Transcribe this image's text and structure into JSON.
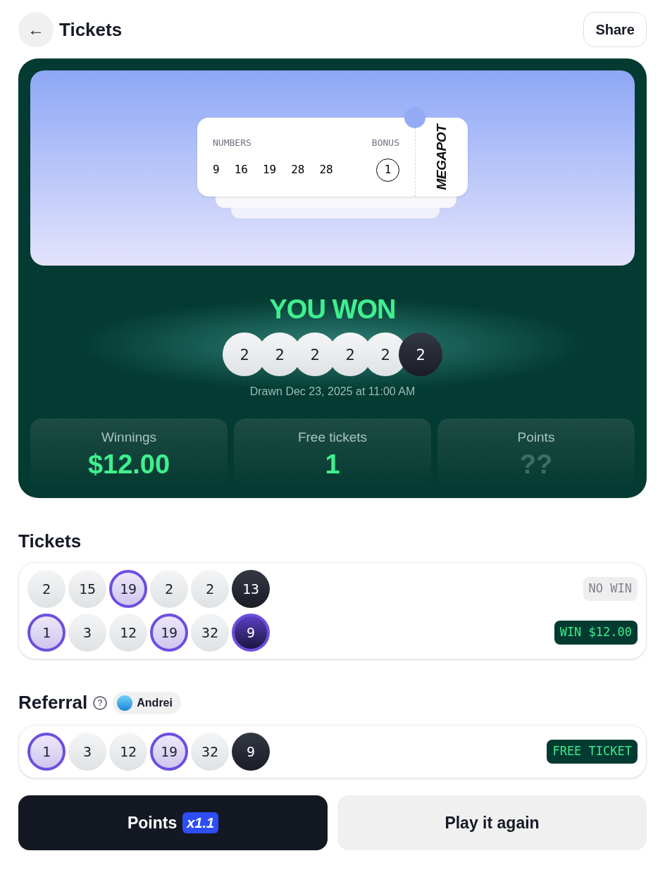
{
  "header": {
    "back": "←",
    "title": "Tickets",
    "share": "Share"
  },
  "hero": {
    "ticket": {
      "numbers_label": "NUMBERS",
      "bonus_label": "BONUS",
      "numbers": [
        "9",
        "16",
        "19",
        "28",
        "28"
      ],
      "bonus": "1",
      "brand": "MEGAPOT"
    }
  },
  "result": {
    "title": "YOU WON",
    "balls": [
      {
        "value": "2",
        "bonus": false
      },
      {
        "value": "2",
        "bonus": false
      },
      {
        "value": "2",
        "bonus": false
      },
      {
        "value": "2",
        "bonus": false
      },
      {
        "value": "2",
        "bonus": false
      },
      {
        "value": "2",
        "bonus": true
      }
    ],
    "drawn": "Drawn Dec 23, 2025 at 11:00 AM"
  },
  "stats": [
    {
      "label": "Winnings",
      "value": "$12.00",
      "revealed": true
    },
    {
      "label": "Free tickets",
      "value": "1",
      "revealed": true
    },
    {
      "label": "Points",
      "value": "??",
      "revealed": false
    }
  ],
  "tickets": {
    "heading": "Tickets",
    "rows": [
      {
        "balls": [
          {
            "value": "2",
            "matched": false,
            "bonus": false
          },
          {
            "value": "15",
            "matched": false,
            "bonus": false
          },
          {
            "value": "19",
            "matched": true,
            "bonus": false
          },
          {
            "value": "2",
            "matched": false,
            "bonus": false
          },
          {
            "value": "2",
            "matched": false,
            "bonus": false
          },
          {
            "value": "13",
            "matched": false,
            "bonus": true
          }
        ],
        "badge": {
          "kind": "no_win",
          "text": "NO WIN"
        }
      },
      {
        "balls": [
          {
            "value": "1",
            "matched": true,
            "bonus": false
          },
          {
            "value": "3",
            "matched": false,
            "bonus": false
          },
          {
            "value": "12",
            "matched": false,
            "bonus": false
          },
          {
            "value": "19",
            "matched": true,
            "bonus": false
          },
          {
            "value": "32",
            "matched": false,
            "bonus": false
          },
          {
            "value": "9",
            "matched": true,
            "bonus": true
          }
        ],
        "badge": {
          "kind": "win",
          "text": "WIN $12.00"
        }
      }
    ]
  },
  "referral": {
    "heading": "Referral",
    "help": "?",
    "user": "Andrei",
    "rows": [
      {
        "balls": [
          {
            "value": "1",
            "matched": true,
            "bonus": false
          },
          {
            "value": "3",
            "matched": false,
            "bonus": false
          },
          {
            "value": "12",
            "matched": false,
            "bonus": false
          },
          {
            "value": "19",
            "matched": true,
            "bonus": false
          },
          {
            "value": "32",
            "matched": false,
            "bonus": false
          },
          {
            "value": "9",
            "matched": false,
            "bonus": true
          }
        ],
        "badge": {
          "kind": "win",
          "text": "FREE TICKET"
        }
      }
    ]
  },
  "actions": {
    "points": {
      "label": "Points",
      "multiplier": "x1.1"
    },
    "again": "Play it again"
  }
}
